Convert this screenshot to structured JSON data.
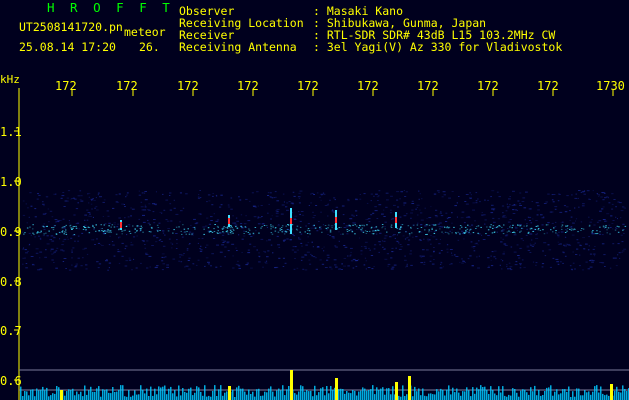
{
  "header": {
    "title": "H R O F F T",
    "file": "UT2508141720.pn",
    "category": "meteor",
    "datetime": "25.08.14 17:20",
    "count": "26.",
    "fields": [
      {
        "label": "Observer",
        "value": ": Masaki Kano"
      },
      {
        "label": "Receiving Location",
        "value": ": Shibukawa, Gunma, Japan"
      },
      {
        "label": "Receiver",
        "value": ": RTL-SDR SDR# 43dB L15 103.2MHz CW"
      },
      {
        "label": "Receiving Antenna",
        "value": ": 3el Yagi(V) Az 330 for Vladivostok"
      }
    ]
  },
  "axis": {
    "unit": "kHz",
    "time_labels": [
      "172",
      "172",
      "172",
      "172",
      "172",
      "172",
      "172",
      "172",
      "172",
      "1730"
    ],
    "freq_labels": [
      "1.1",
      "1.0",
      "0.9",
      "0.8",
      "0.7",
      "0.6"
    ]
  },
  "colors": {
    "background": "#00001e",
    "text": "#ffff00",
    "title": "#00ff00",
    "axis_line": "#ffff00",
    "noise": "#1a2a9a",
    "signal": "#40e0ff",
    "strong": "#ff3030",
    "base": "#00c8ff"
  }
}
